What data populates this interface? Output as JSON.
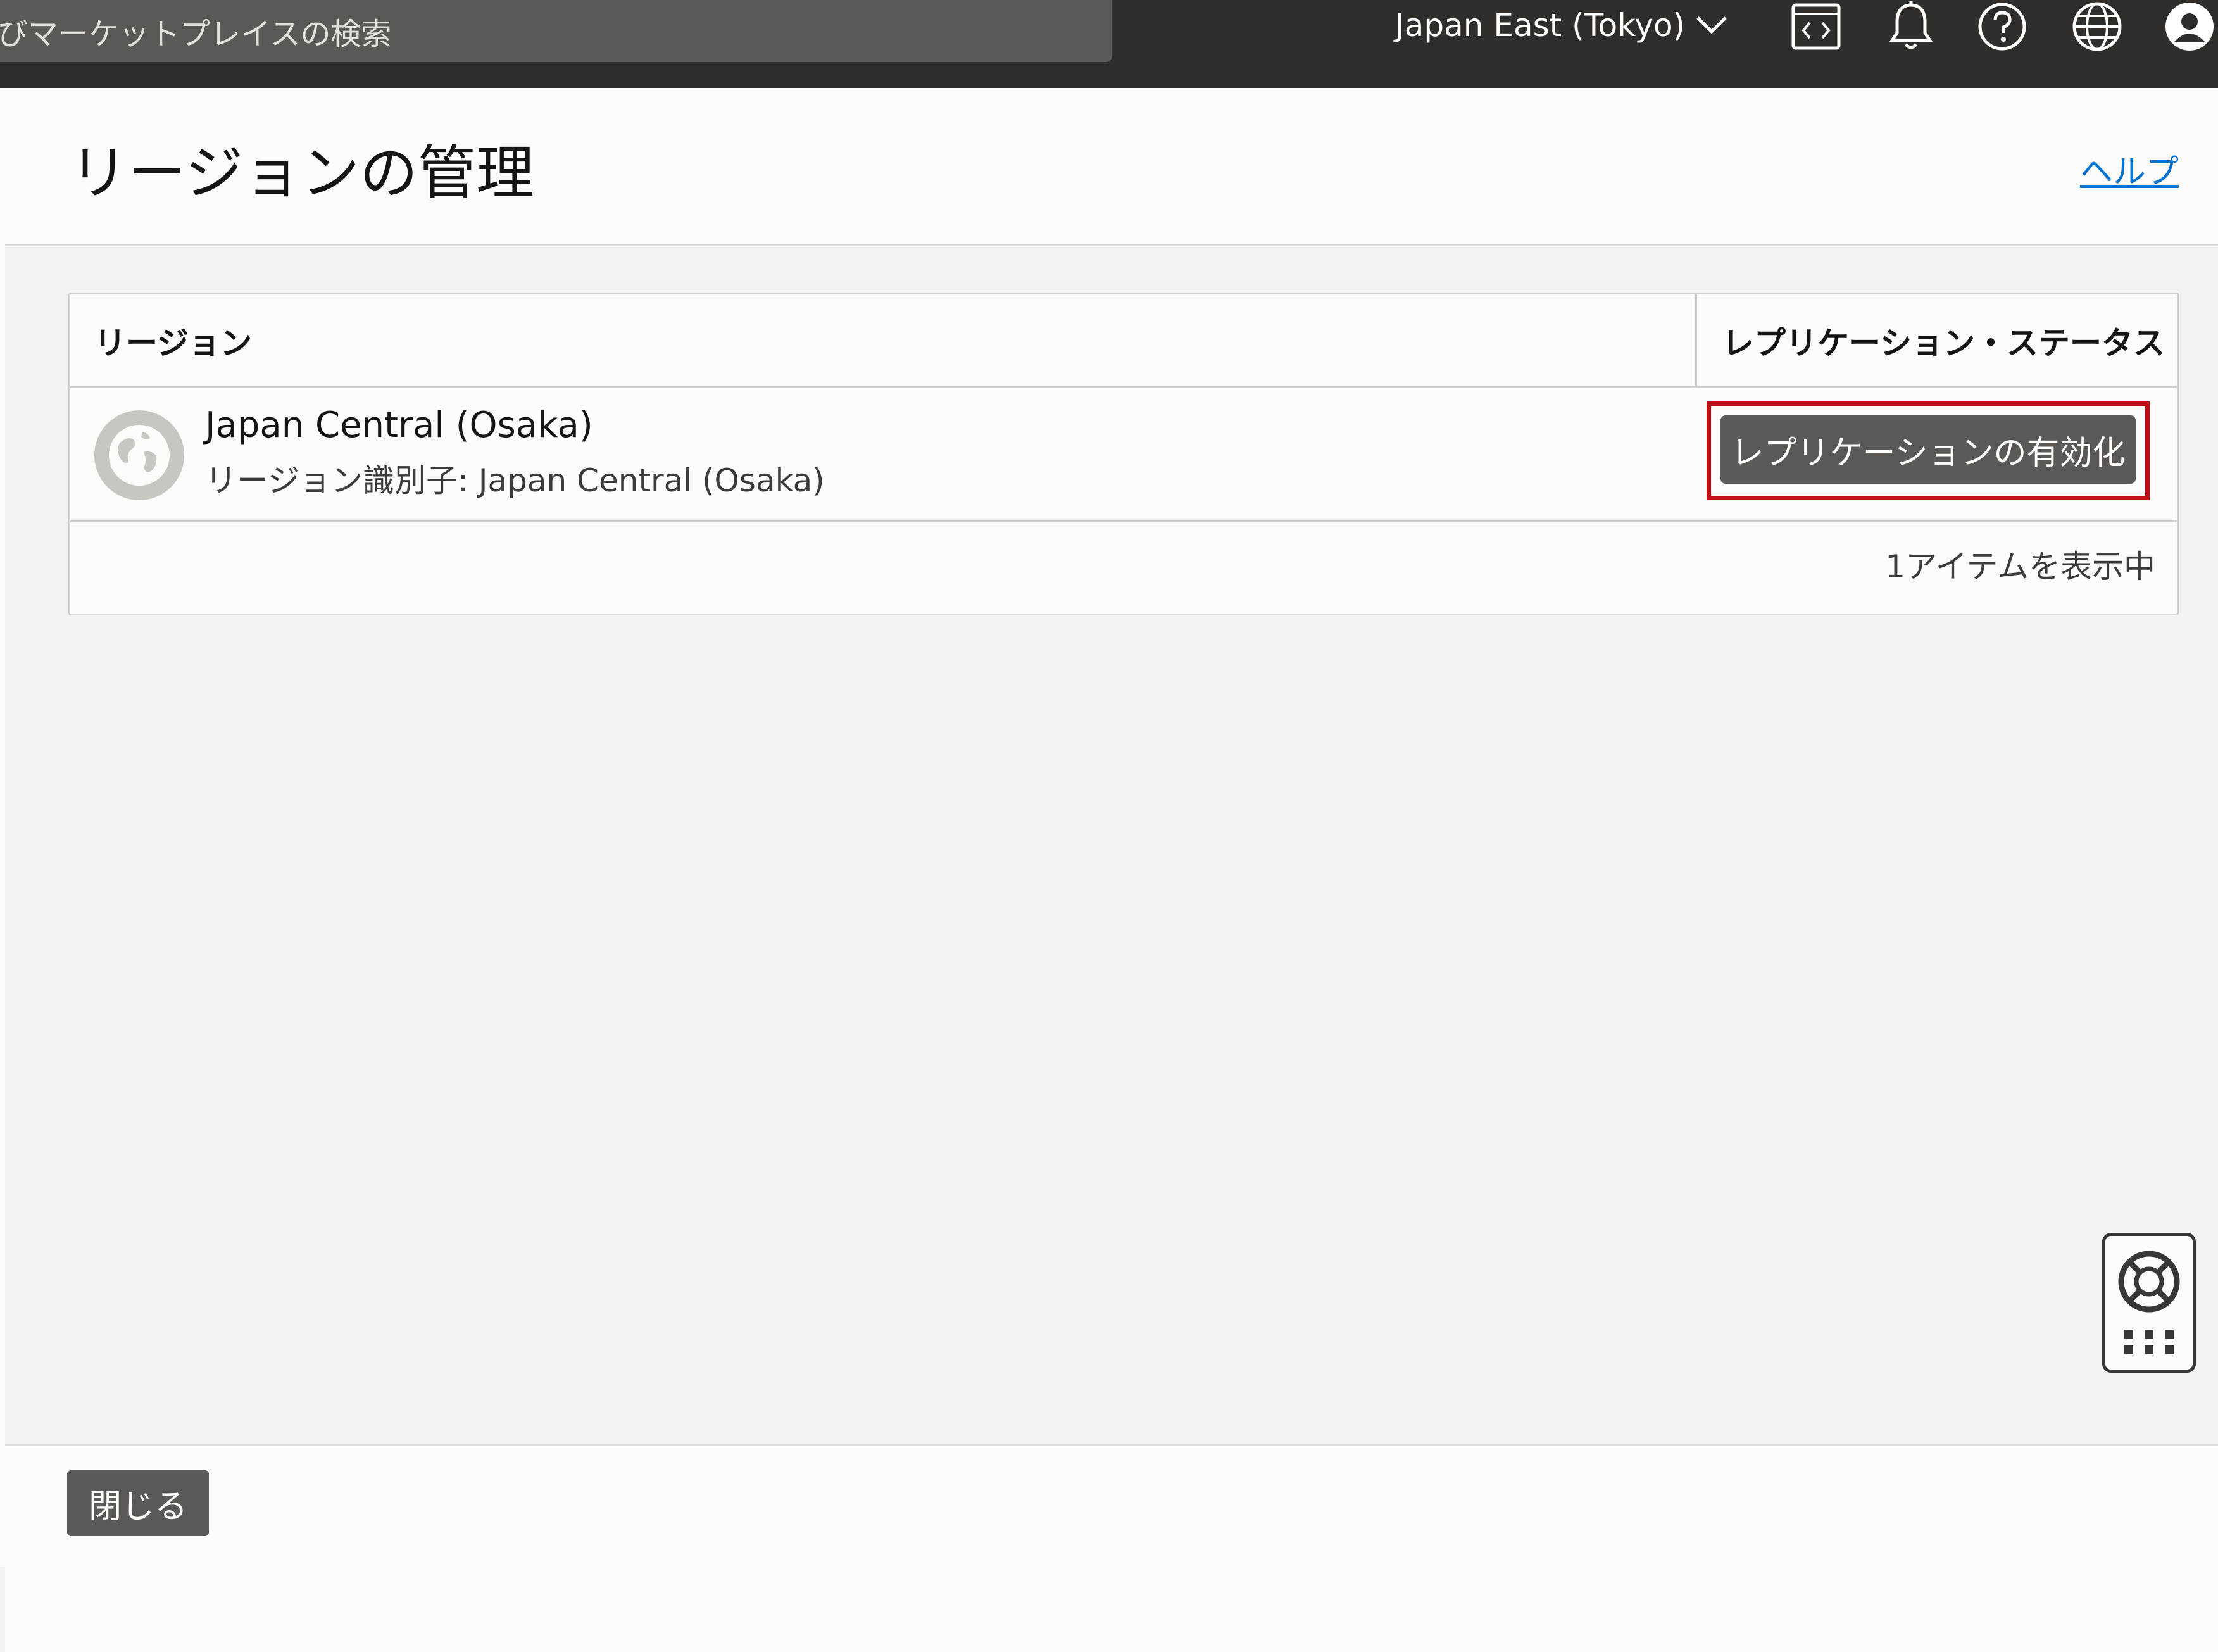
{
  "topbar": {
    "search_text": "びマーケットプレイスの検索",
    "region_label": "Japan East (Tokyo)",
    "icons": [
      "code-editor-icon",
      "bell-icon",
      "help-circle-icon",
      "globe-icon",
      "user-icon"
    ]
  },
  "panel": {
    "title": "リージョンの管理",
    "help_link": "ヘルプ"
  },
  "table": {
    "columns": [
      "リージョン",
      "レプリケーション・ステータス"
    ],
    "rows": [
      {
        "name": "Japan Central (Osaka)",
        "identifier": "リージョン識別子: Japan Central (Osaka)",
        "action_label": "レプリケーションの有効化"
      }
    ],
    "count_text": "1アイテムを表示中"
  },
  "footer": {
    "close_label": "閉じる"
  },
  "colors": {
    "topbar_bg": "#312d2a",
    "button_bg": "#5c5855",
    "highlight": "#c00d16",
    "link": "#0572ce"
  }
}
